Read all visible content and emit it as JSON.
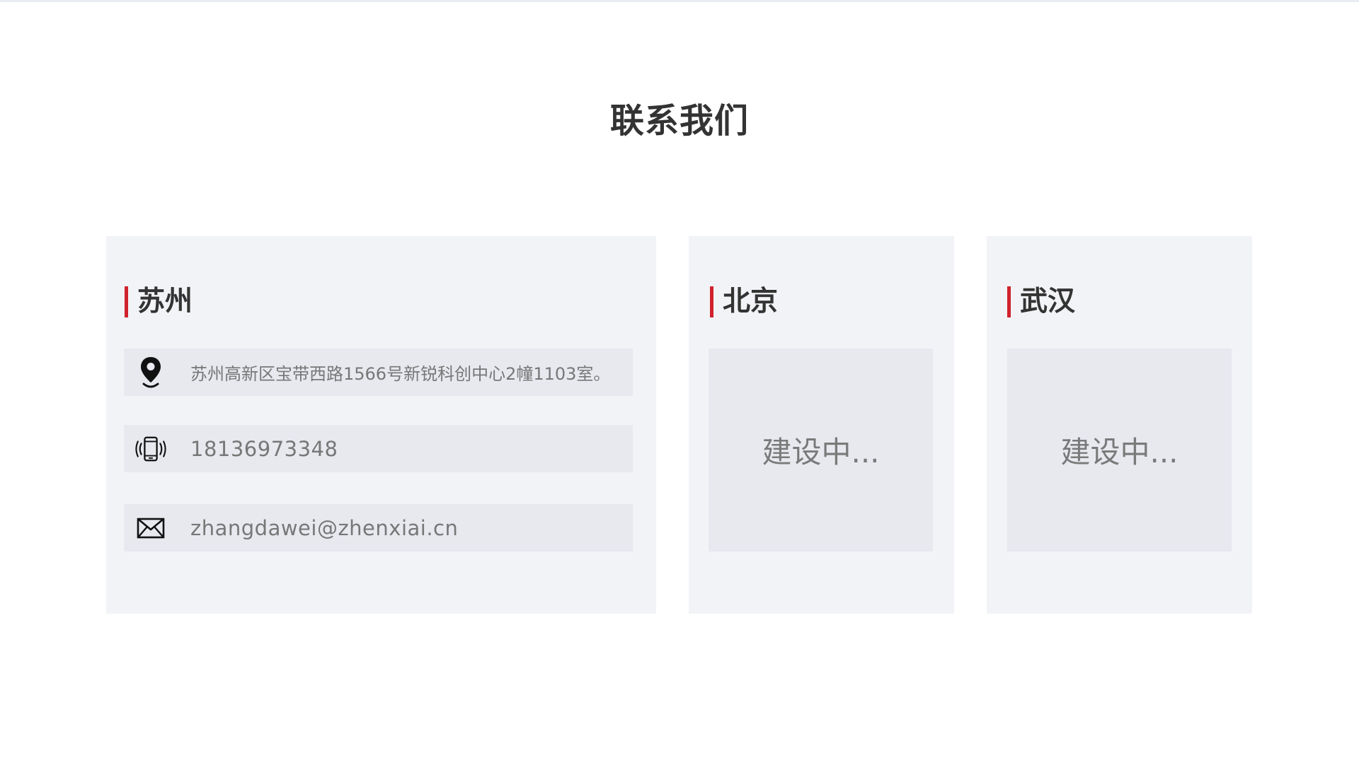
{
  "section": {
    "title": "联系我们"
  },
  "offices": {
    "suzhou": {
      "city": "苏州",
      "address": "苏州高新区宝带西路1566号新锐科创中心2幢1103室。",
      "phone": "18136973348",
      "email": "zhangdawei@zhenxiai.cn",
      "icons": [
        "location-pin-icon",
        "vibrating-phone-icon",
        "envelope-icon"
      ]
    },
    "beijing": {
      "city": "北京",
      "status": "建设中..."
    },
    "wuhan": {
      "city": "武汉",
      "status": "建设中..."
    }
  },
  "colors": {
    "accent": "#d0222c",
    "card_bg": "#f2f3f6",
    "row_bg": "#e7e9ef",
    "heading_text": "#333333",
    "muted_text": "#777777"
  }
}
